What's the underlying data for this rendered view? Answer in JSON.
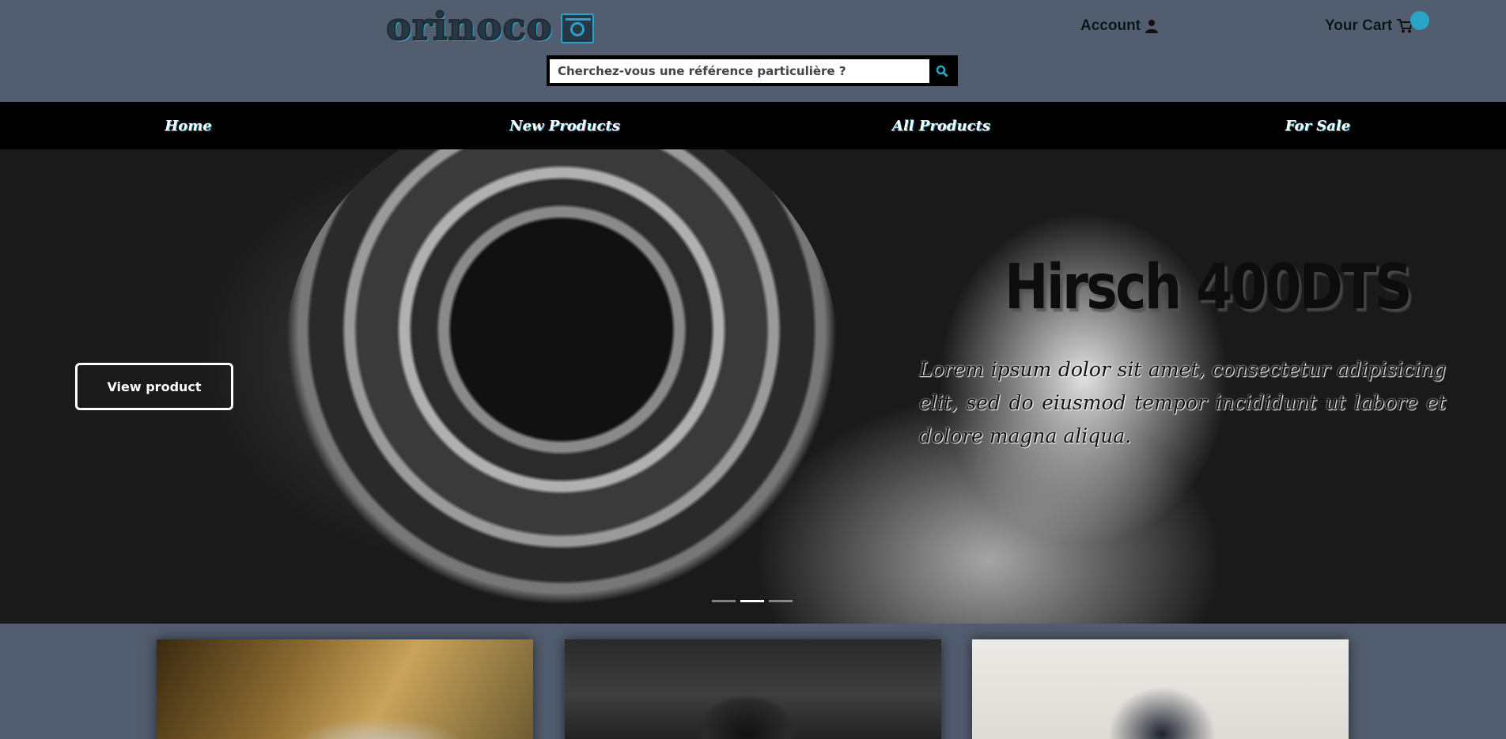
{
  "brand": {
    "logo_text": "orinoco",
    "logo_icon": "camera-icon",
    "accent_color": "#2aa4c4",
    "background_color": "#525d6f"
  },
  "header": {
    "account_label": "Account",
    "account_icon": "user-icon",
    "cart_label": "Your Cart",
    "cart_icon": "cart-icon"
  },
  "search": {
    "placeholder": "Cherchez-vous une référence particulière ?",
    "button_icon": "search-icon"
  },
  "nav": {
    "items": [
      {
        "label": "Home"
      },
      {
        "label": "New Products"
      },
      {
        "label": "All Products"
      },
      {
        "label": "For Sale"
      }
    ]
  },
  "hero": {
    "title": "Hirsch 400DTS",
    "description": "Lorem ipsum dolor sit amet, consectetur adipisicing elit, sed do eiusmod tempor incididunt ut labore et dolore magna aliqua.",
    "button_label": "View product",
    "slide_count": 3,
    "active_slide": 2
  },
  "cards": [
    {
      "name": "product-card-1"
    },
    {
      "name": "product-card-2"
    },
    {
      "name": "product-card-3"
    }
  ]
}
